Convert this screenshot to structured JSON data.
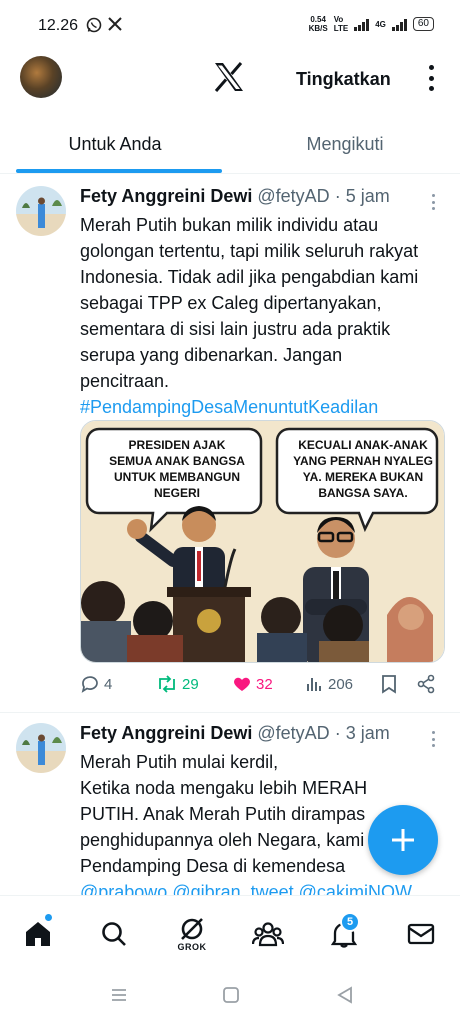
{
  "status_bar": {
    "time": "12.26",
    "net_speed_value": "0.54",
    "net_speed_unit": "KB/S",
    "volte_top": "Vo",
    "volte_bottom": "LTE",
    "network": "4G",
    "battery": "60"
  },
  "header": {
    "upgrade_label": "Tingkatkan"
  },
  "tabs": [
    {
      "label": "Untuk Anda",
      "active": true
    },
    {
      "label": "Mengikuti",
      "active": false
    }
  ],
  "tweets": [
    {
      "name": "Fety Anggreini Dewi",
      "handle": "@fetyAD",
      "separator": "·",
      "time": "5 jam",
      "text": "Merah Putih bukan milik individu atau golongan tertentu, tapi milik seluruh rakyat Indonesia. Tidak adil jika pengabdian kami sebagai TPP ex Caleg dipertanyakan, sementara di sisi lain justru ada praktik serupa yang dibenarkan. Jangan pencitraan.",
      "hashtag": "#PendampingDesaMenuntutKeadilan",
      "media": {
        "bubble_left": [
          "PRESIDEN AJAK",
          "SEMUA ANAK BANGSA",
          "UNTUK MEMBANGUN",
          "NEGERI"
        ],
        "bubble_right": [
          "KECUALI ANAK-ANAK",
          "YANG PERNAH NYALEG",
          "YA. MEREKA BUKAN",
          "BANGSA SAYA."
        ]
      },
      "replies": "4",
      "reposts": "29",
      "likes": "32",
      "views": "206"
    },
    {
      "name": "Fety Anggreini Dewi",
      "handle": "@fetyAD",
      "separator": "·",
      "time": "3 jam",
      "lines": [
        "Merah Putih mulai kerdil,",
        "Ketika noda mengaku lebih MERAH",
        "PUTIH. Anak Merah Putih dirampas",
        "penghidupannya oleh Negara, kami",
        "Pendamping Desa di kemendesa"
      ],
      "mentions": "@prabowo @gibran_tweet @cakimiNOW"
    }
  ],
  "bottom_nav": {
    "grok_label": "GROK",
    "notification_count": "5"
  },
  "colors": {
    "accent": "#1d9bf0",
    "text": "#0f1419",
    "muted": "#536471",
    "like": "#f91880",
    "repost": "#00ba7c"
  }
}
